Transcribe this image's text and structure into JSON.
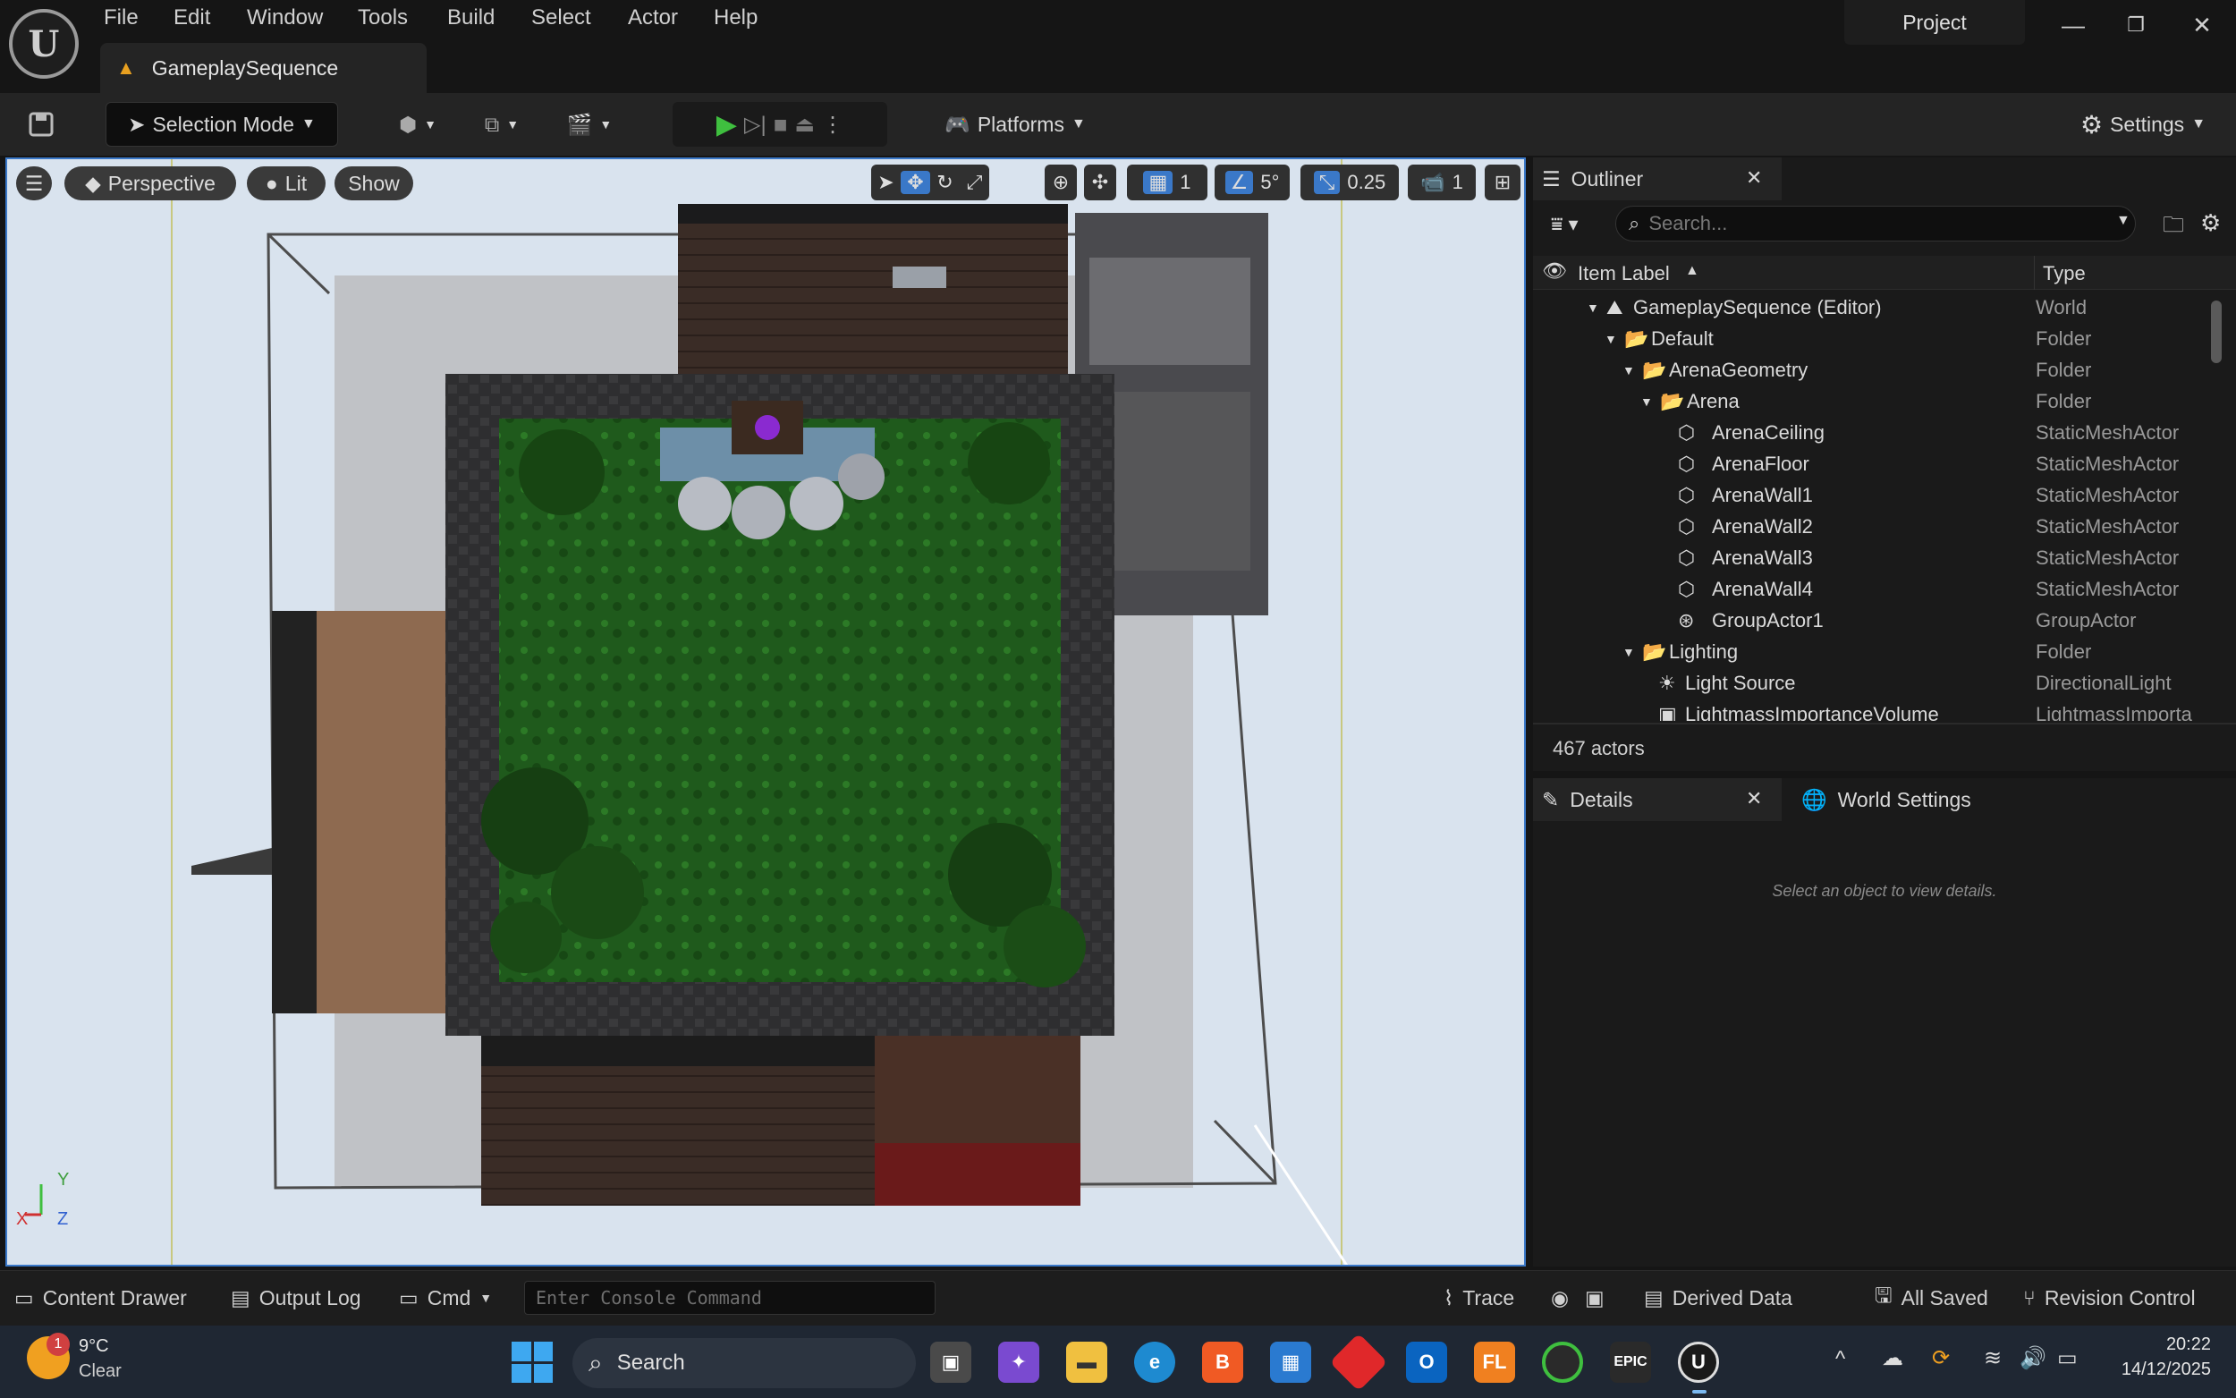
{
  "menu": [
    "File",
    "Edit",
    "Window",
    "Tools",
    "Build",
    "Select",
    "Actor",
    "Help"
  ],
  "document_tab": "GameplaySequence",
  "project_label": "Project",
  "toolbar": {
    "selection_mode": "Selection Mode",
    "platforms": "Platforms",
    "settings": "Settings"
  },
  "viewport": {
    "perspective": "Perspective",
    "lit": "Lit",
    "show": "Show",
    "grid_size": "1",
    "angle_snap": "5°",
    "scale_snap": "0.25",
    "camera_speed": "1",
    "axis_y": "Y",
    "axis_x": "X",
    "axis_z": "Z"
  },
  "outliner": {
    "title": "Outliner",
    "search_placeholder": "Search...",
    "col_label": "Item Label",
    "col_type": "Type",
    "rows": [
      {
        "label": "GameplaySequence (Editor)",
        "type": "World"
      },
      {
        "label": "Default",
        "type": "Folder"
      },
      {
        "label": "ArenaGeometry",
        "type": "Folder"
      },
      {
        "label": "Arena",
        "type": "Folder"
      },
      {
        "label": "ArenaCeiling",
        "type": "StaticMeshActor"
      },
      {
        "label": "ArenaFloor",
        "type": "StaticMeshActor"
      },
      {
        "label": "ArenaWall1",
        "type": "StaticMeshActor"
      },
      {
        "label": "ArenaWall2",
        "type": "StaticMeshActor"
      },
      {
        "label": "ArenaWall3",
        "type": "StaticMeshActor"
      },
      {
        "label": "ArenaWall4",
        "type": "StaticMeshActor"
      },
      {
        "label": "GroupActor1",
        "type": "GroupActor"
      },
      {
        "label": "Lighting",
        "type": "Folder"
      },
      {
        "label": "Light Source",
        "type": "DirectionalLight"
      },
      {
        "label": "LightmassImportanceVolume",
        "type": "LightmassImporta"
      }
    ],
    "actor_count": "467 actors"
  },
  "details": {
    "title": "Details",
    "world_settings": "World Settings",
    "empty_message": "Select an object to view details."
  },
  "statusbar": {
    "content_drawer": "Content Drawer",
    "output_log": "Output Log",
    "cmd": "Cmd",
    "console_placeholder": "Enter Console Command",
    "trace": "Trace",
    "derived_data": "Derived Data",
    "all_saved": "All Saved",
    "revision_control": "Revision Control"
  },
  "taskbar": {
    "weather_badge": "1",
    "temperature": "9°C",
    "weather": "Clear",
    "search": "Search",
    "time": "20:22",
    "date": "14/12/2025"
  },
  "colors": {
    "accent": "#3a78c8",
    "play_green": "#3fbf3f",
    "viewport_bg": "#d9e3ee",
    "grass": "#1f5a1c"
  }
}
